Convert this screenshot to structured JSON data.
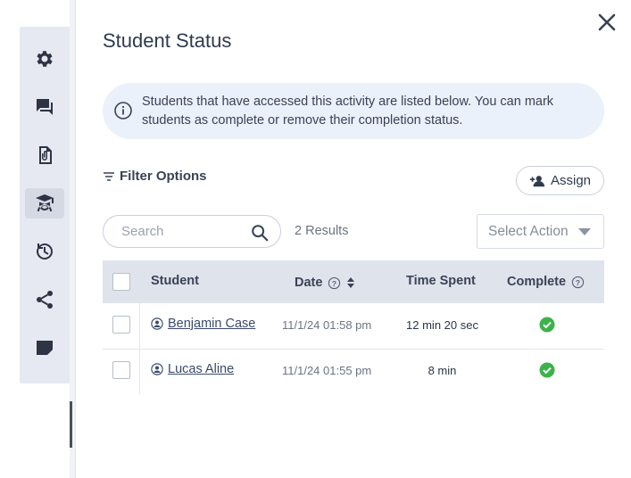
{
  "panel": {
    "title": "Student Status",
    "info": "Students that have accessed this activity are listed below. You can mark students as complete or remove their completion status."
  },
  "sidebar": {
    "items": [
      {
        "icon": "gear-icon",
        "active": false
      },
      {
        "icon": "chat-icon",
        "active": false
      },
      {
        "icon": "attachment-file-icon",
        "active": false
      },
      {
        "icon": "student-icon",
        "active": true
      },
      {
        "icon": "history-icon",
        "active": false
      },
      {
        "icon": "share-icon",
        "active": false
      },
      {
        "icon": "note-icon",
        "active": false
      }
    ]
  },
  "toolbar": {
    "filter_label": "Filter Options",
    "assign_label": "Assign",
    "search_placeholder": "Search",
    "results": "2 Results",
    "select_action": "Select Action"
  },
  "table": {
    "headers": {
      "student": "Student",
      "date": "Date",
      "time_spent": "Time Spent",
      "complete": "Complete"
    },
    "rows": [
      {
        "student": "Benjamin Case",
        "date": "11/1/24 01:58 pm",
        "time_spent": "12 min 20 sec",
        "complete": true
      },
      {
        "student": "Lucas Aline",
        "date": "11/1/24 01:55 pm",
        "time_spent": "8 min",
        "complete": true
      }
    ]
  },
  "colors": {
    "accent": "#2e3444",
    "info_bg": "#eaf1fb",
    "header_bg": "#dfe3ec",
    "success": "#3bb34a"
  }
}
